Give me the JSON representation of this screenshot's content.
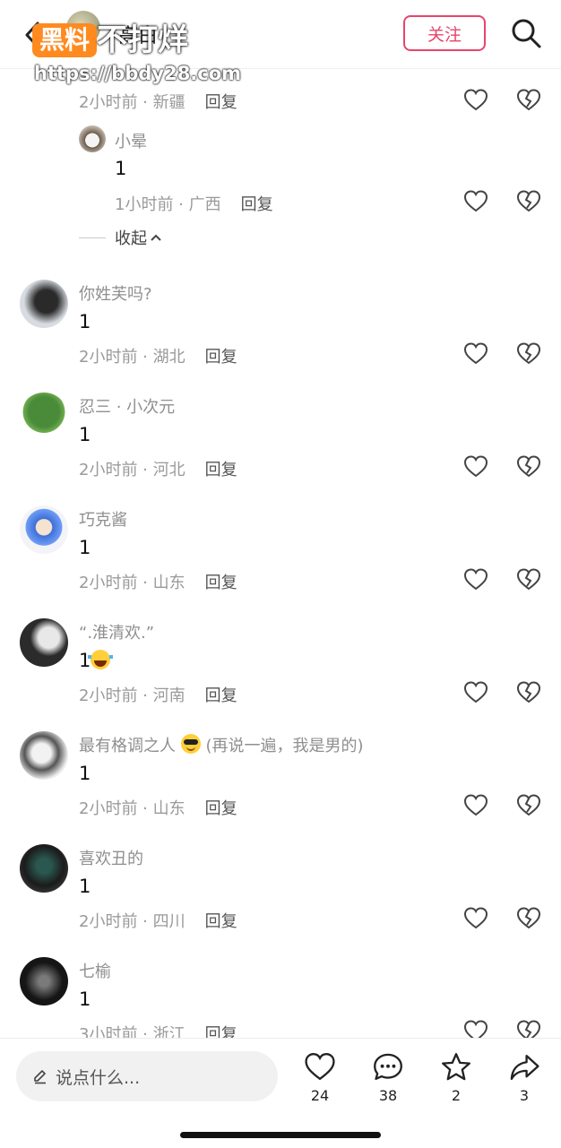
{
  "header": {
    "author_name": "高白",
    "follow_label": "关注",
    "watermark": {
      "logo": "黑料",
      "slogan": "不打烊",
      "url": "https://bbdy28.com"
    }
  },
  "comments": [
    {
      "meta": "2小时前 · 新疆",
      "reply": "回复"
    },
    {
      "name": "小晕",
      "text": "1",
      "meta": "1小时前 · 广西",
      "reply": "回复"
    },
    {
      "collapse": "收起"
    },
    {
      "name": "你姓芙吗?",
      "text": "1",
      "meta": "2小时前 · 湖北",
      "reply": "回复"
    },
    {
      "name": "忍三 · 小次元",
      "text": "1",
      "meta": "2小时前 · 河北",
      "reply": "回复"
    },
    {
      "name": "巧克酱",
      "text": "1",
      "meta": "2小时前 · 山东",
      "reply": "回复"
    },
    {
      "name": "“.淮清欢.”",
      "text": "1",
      "emoji": "laughing-crying-emoji",
      "meta": "2小时前 · 河南",
      "reply": "回复"
    },
    {
      "name": "最有格调之人",
      "name_emoji": "sunglasses-emoji",
      "name_suffix": "(再说一遍，我是男的)",
      "text": "1",
      "meta": "2小时前 · 山东",
      "reply": "回复"
    },
    {
      "name": "喜欢丑的",
      "text": "1",
      "meta": "2小时前 · 四川",
      "reply": "回复"
    },
    {
      "name": "七榆",
      "text": "1",
      "meta": "3小时前 · 浙江",
      "reply": "回复"
    }
  ],
  "bottom": {
    "placeholder": "说点什么...",
    "likes": "24",
    "comments": "38",
    "favorites": "2",
    "shares": "3"
  },
  "colors": {
    "accent": "#e8446b",
    "watermark": "#ff8a1f"
  }
}
